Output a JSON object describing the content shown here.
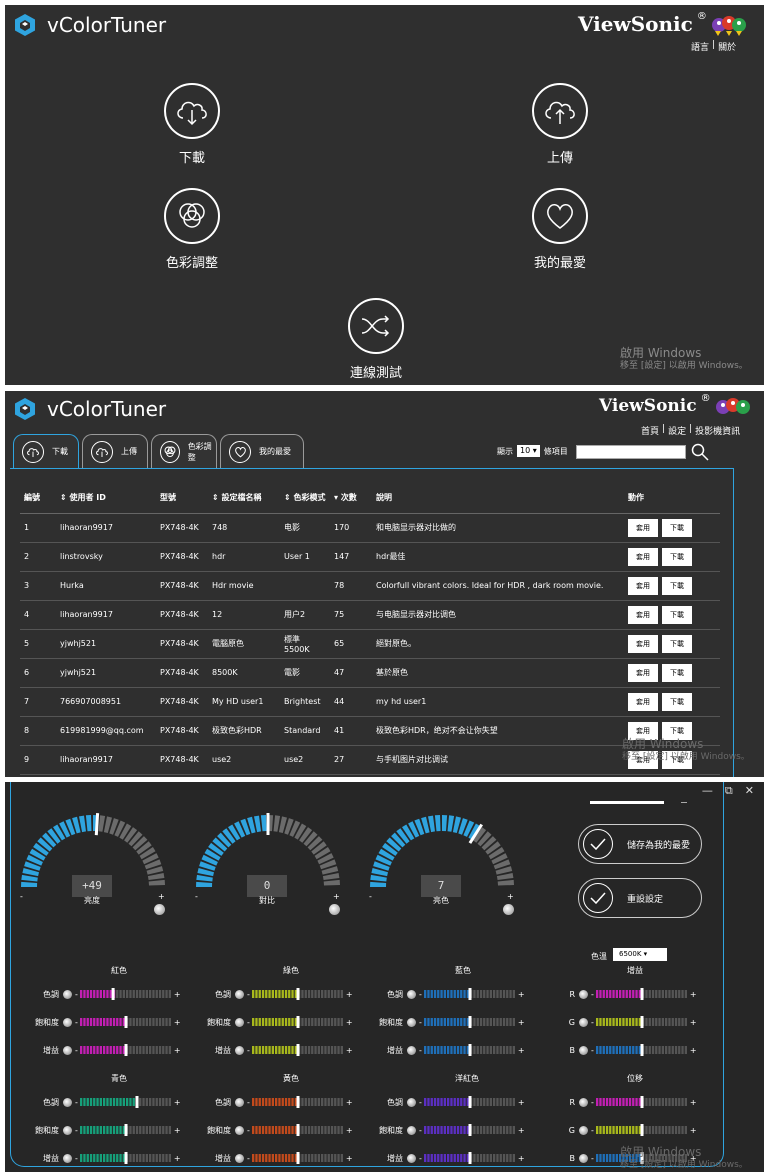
{
  "colors": {
    "accent": "#2fa4df",
    "panel": "#2f2f2f",
    "track": "#555555"
  },
  "app": {
    "name": "vColorTuner",
    "brand": "ViewSonic",
    "reg": "®"
  },
  "home": {
    "links": [
      "語言",
      "關於"
    ],
    "sep": "|",
    "tiles": [
      {
        "label": "下載",
        "icon": "cloud-download-icon"
      },
      {
        "label": "上傳",
        "icon": "cloud-upload-icon"
      },
      {
        "label": "色彩調整",
        "icon": "color-circles-icon"
      },
      {
        "label": "我的最愛",
        "icon": "heart-icon"
      },
      {
        "label": "連線測試",
        "icon": "shuffle-icon"
      }
    ],
    "watermark": {
      "line1": "啟用 Windows",
      "line2": "移至 [設定] 以啟用 Windows。"
    }
  },
  "download": {
    "links": [
      "首頁",
      "設定",
      "投影機資訊"
    ],
    "sep": "|",
    "tabs": [
      "下載",
      "上傳",
      "色彩調整",
      "我的最愛"
    ],
    "show_label": "顯示",
    "show_value": "10",
    "show_suffix": "條項目",
    "headers": [
      "編號",
      "使用者 ID",
      "型號",
      "設定檔名稱",
      "色彩模式",
      "次數",
      "說明",
      "動作"
    ],
    "rows": [
      [
        "1",
        "lihaoran9917",
        "PX748-4K",
        "748",
        "电影",
        "170",
        "和电脑显示器对比做的"
      ],
      [
        "2",
        "linstrovsky",
        "PX748-4K",
        "hdr",
        "User 1",
        "147",
        "hdr最佳"
      ],
      [
        "3",
        "Hurka",
        "PX748-4K",
        "Hdr movie",
        "",
        "78",
        "Colorfull vibrant colors. Ideal for HDR , dark room movie."
      ],
      [
        "4",
        "lihaoran9917",
        "PX748-4K",
        "12",
        "用户2",
        "75",
        "与电脑显示器对比调色"
      ],
      [
        "5",
        "yjwhj521",
        "PX748-4K",
        "電腦原色",
        "標準 5500K",
        "65",
        "絕對原色。"
      ],
      [
        "6",
        "yjwhj521",
        "PX748-4K",
        "8500K",
        "電影",
        "47",
        "基於原色"
      ],
      [
        "7",
        "766907008951",
        "PX748-4K",
        "My HD user1",
        "Brightest",
        "44",
        "my hd user1"
      ],
      [
        "8",
        "619981999@qq.com",
        "PX748-4K",
        "极致色彩HDR",
        "Standard",
        "41",
        "极致色彩HDR，绝对不会让你失望"
      ],
      [
        "9",
        "lihaoran9917",
        "PX748-4K",
        "use2",
        "use2",
        "27",
        "与手机图片对比调试"
      ]
    ],
    "apply_label": "套用",
    "download_label": "下載",
    "watermark": {
      "line1": "啟用 Windows",
      "line2": "移至 [設定] 以啟用 Windows。"
    }
  },
  "adjust": {
    "window": {
      "minimize": "—",
      "restore": "⧉",
      "close": "✕"
    },
    "gauges": [
      {
        "label": "亮度",
        "value": "+49",
        "level": 0.52
      },
      {
        "label": "對比",
        "value": "0",
        "level": 0.5
      },
      {
        "label": "亮色",
        "value": "7",
        "level": 0.68
      }
    ],
    "minus": "-",
    "plus": "+",
    "save_label": "儲存為我的最愛",
    "reset_label": "重設設定",
    "ct_label": "色溫",
    "ct_value": "6500K",
    "groups": [
      {
        "title": "紅色",
        "rows": [
          {
            "label": "色調",
            "color": "#c21fb3",
            "level": 0.36
          },
          {
            "label": "飽和度",
            "color": "#c21fb3",
            "level": 0.5
          },
          {
            "label": "增益",
            "color": "#c21fb3",
            "level": 0.5
          }
        ]
      },
      {
        "title": "綠色",
        "rows": [
          {
            "label": "色調",
            "color": "#a8b81c",
            "level": 0.5
          },
          {
            "label": "飽和度",
            "color": "#a8b81c",
            "level": 0.5
          },
          {
            "label": "增益",
            "color": "#a8b81c",
            "level": 0.5
          }
        ]
      },
      {
        "title": "藍色",
        "rows": [
          {
            "label": "色調",
            "color": "#1f6fb8",
            "level": 0.5
          },
          {
            "label": "飽和度",
            "color": "#1f6fb8",
            "level": 0.5
          },
          {
            "label": "增益",
            "color": "#1f6fb8",
            "level": 0.5
          }
        ]
      },
      {
        "title": "增益",
        "rows": [
          {
            "label": "R",
            "color": "#c21fb3",
            "level": 0.5
          },
          {
            "label": "G",
            "color": "#a8b81c",
            "level": 0.5
          },
          {
            "label": "B",
            "color": "#1f6fb8",
            "level": 0.5
          }
        ]
      },
      {
        "title": "青色",
        "rows": [
          {
            "label": "色調",
            "color": "#16a07a",
            "level": 0.62
          },
          {
            "label": "飽和度",
            "color": "#16a07a",
            "level": 0.5
          },
          {
            "label": "增益",
            "color": "#16a07a",
            "level": 0.5
          }
        ]
      },
      {
        "title": "黃色",
        "rows": [
          {
            "label": "色調",
            "color": "#c24a1c",
            "level": 0.5
          },
          {
            "label": "飽和度",
            "color": "#c24a1c",
            "level": 0.5
          },
          {
            "label": "增益",
            "color": "#c24a1c",
            "level": 0.5
          }
        ]
      },
      {
        "title": "洋紅色",
        "rows": [
          {
            "label": "色調",
            "color": "#5b2fc2",
            "level": 0.5
          },
          {
            "label": "飽和度",
            "color": "#5b2fc2",
            "level": 0.5
          },
          {
            "label": "增益",
            "color": "#5b2fc2",
            "level": 0.5
          }
        ]
      },
      {
        "title": "位移",
        "rows": [
          {
            "label": "R",
            "color": "#c21fb3",
            "level": 0.5
          },
          {
            "label": "G",
            "color": "#a8b81c",
            "level": 0.5
          },
          {
            "label": "B",
            "color": "#1f6fb8",
            "level": 0.5
          }
        ]
      }
    ],
    "watermark": {
      "line1": "啟用 Windows",
      "line2": "移至 [設定] 以啟用 Windows。"
    }
  }
}
